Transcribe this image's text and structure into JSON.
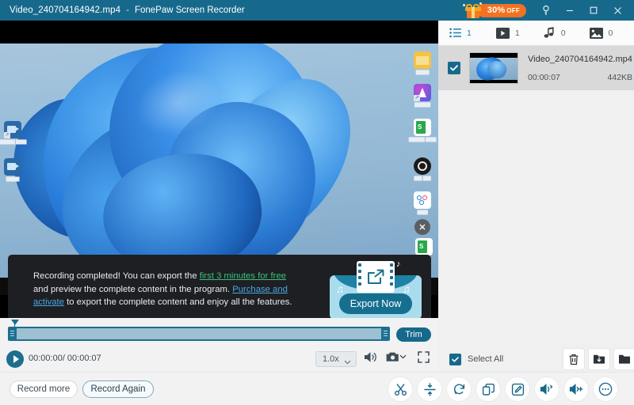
{
  "titlebar": {
    "file_name": "Video_240704164942.mp4",
    "separator": "-",
    "app_name": "FonePaw Screen Recorder",
    "promo_badge": "30%",
    "promo_suffix": "OFF",
    "icons": {
      "gift": "gift-icon",
      "key": "key-icon",
      "minimize": "minimize-icon",
      "maximize": "maximize-icon",
      "close": "close-icon"
    }
  },
  "notification": {
    "line1_a": "Recording completed! You can export the ",
    "link_free": "first 3 minutes for free",
    "line2_a": "and preview the complete content in the program. ",
    "link_purchase": "Purchase and activate",
    "line3_b": " to export the complete content and enjoy all the features.",
    "export_button": "Export Now"
  },
  "player": {
    "trim_button": "Trim",
    "current_time": "00:00:00",
    "time_separator": "/",
    "total_time": "00:00:07",
    "time_display": "00:00:00/ 00:00:07",
    "speed": "1.0x",
    "icons": {
      "play": "play-icon",
      "volume": "volume-icon",
      "snapshot": "camera-icon",
      "snapshot_chevron": "chevron-down-icon",
      "fullscreen": "fullscreen-icon",
      "speed_chevron": "chevron-down-icon"
    }
  },
  "bottombar": {
    "record_more": "Record more",
    "record_again": "Record Again",
    "tools": [
      {
        "name": "cut-tool",
        "icon": "scissors-icon"
      },
      {
        "name": "compress-tool",
        "icon": "compress-icon"
      },
      {
        "name": "convert-tool",
        "icon": "refresh-icon"
      },
      {
        "name": "merge-tool",
        "icon": "merge-icon"
      },
      {
        "name": "edit-tool",
        "icon": "pencil-square-icon"
      },
      {
        "name": "audio-convert-tool",
        "icon": "speaker-convert-icon"
      },
      {
        "name": "volume-boost-tool",
        "icon": "speaker-plus-icon"
      },
      {
        "name": "more-tools",
        "icon": "ellipsis-icon"
      }
    ]
  },
  "right_panel": {
    "tabs": [
      {
        "name": "tab-all",
        "icon": "list-icon",
        "count": "1",
        "active": true
      },
      {
        "name": "tab-video",
        "icon": "video-icon",
        "count": "1",
        "active": false
      },
      {
        "name": "tab-audio",
        "icon": "music-icon",
        "count": "0",
        "active": false
      },
      {
        "name": "tab-image",
        "icon": "image-icon",
        "count": "0",
        "active": false
      }
    ],
    "files": [
      {
        "name": "Video_240704164942.mp4",
        "duration": "00:00:07",
        "size": "442KB",
        "checked": true
      }
    ],
    "select_all_label": "Select All",
    "select_all_checked": true,
    "actions": [
      {
        "name": "delete-button",
        "icon": "trash-icon"
      },
      {
        "name": "export-folder-button",
        "icon": "folder-export-icon"
      },
      {
        "name": "open-folder-button",
        "icon": "folder-open-icon"
      }
    ]
  },
  "desktop": {
    "left_icons": [
      {
        "label": "██████\n████"
      },
      {
        "label": "█████"
      }
    ],
    "right_icons": [
      {
        "label": "█████"
      },
      {
        "label": "██████"
      },
      {
        "label": "██████\n████"
      },
      {
        "label": "███ ███"
      },
      {
        "label": "████"
      }
    ]
  },
  "colors": {
    "titlebar": "#17698c",
    "accent": "#1d6f8f",
    "promo_orange": "#f4711f",
    "link_green": "#3fbf7f",
    "link_blue": "#4aa8e8",
    "panel_bg": "#f0f0f0",
    "selected_row": "#d9d9d9"
  }
}
